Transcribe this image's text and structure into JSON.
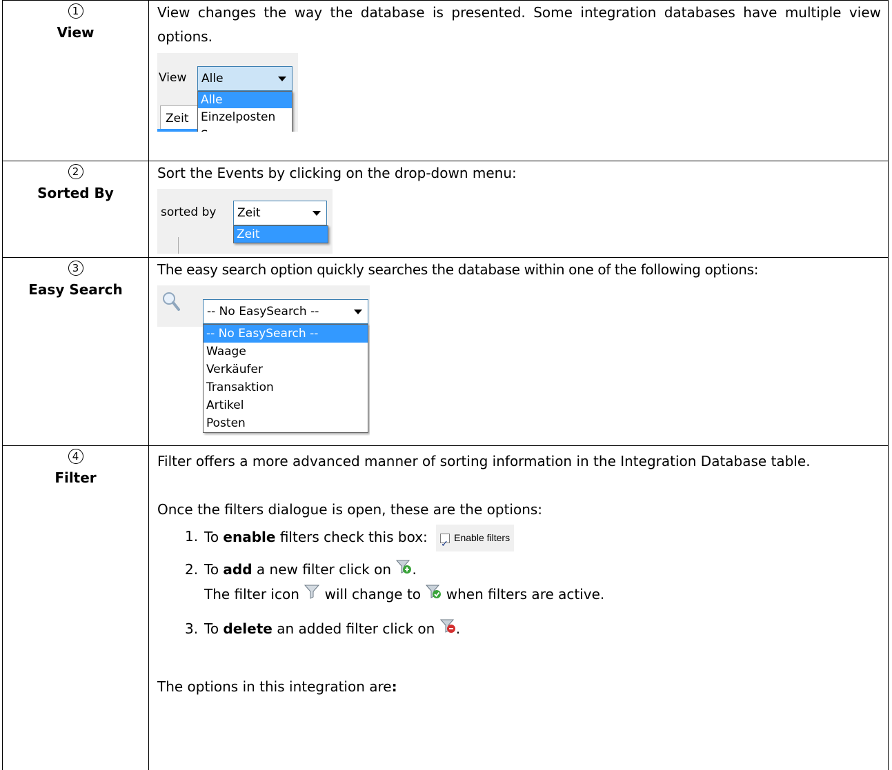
{
  "rows": [
    {
      "number": "1",
      "label": "View",
      "text": "View changes the way the database is presented. Some integration databases have multiple view options.",
      "snapshot": {
        "field_label": "View",
        "selected_value": "Alle",
        "options": [
          "Alle",
          "Einzelposten",
          "Summe"
        ],
        "column_header": "Zeit"
      }
    },
    {
      "number": "2",
      "label": "Sorted By",
      "text": "Sort the Events by clicking on the drop-down menu:",
      "snapshot": {
        "field_label": "sorted by",
        "selected_value": "Zeit",
        "options": [
          "Zeit"
        ]
      }
    },
    {
      "number": "3",
      "label": "Easy Search",
      "text": "The easy search option quickly searches the database within one of the following options:",
      "snapshot": {
        "icon": "magnifier-icon",
        "selected_value": "-- No EasySearch --",
        "options": [
          "-- No EasySearch --",
          "Waage",
          "Verkäufer",
          "Transaktion",
          "Artikel",
          "Posten"
        ]
      }
    },
    {
      "number": "4",
      "label": "Filter",
      "intro": "Filter offers a more advanced manner of sorting information in the Integration Database table.",
      "dialog_text": "Once the filters dialogue is open, these are the options:",
      "steps": [
        {
          "n": "1.",
          "pre": "To ",
          "bold": "enable",
          "post": " filters check this box:",
          "checkbox_label": "Enable filters"
        },
        {
          "n": "2.",
          "pre": "To ",
          "bold": "add",
          "post": " a new filter click on ",
          "end": ".",
          "line2_a": "The filter icon ",
          "line2_b": " will change to ",
          "line2_c": " when filters are active."
        },
        {
          "n": "3.",
          "pre": "To ",
          "bold": "delete",
          "post": " an added filter click on ",
          "end": "."
        }
      ],
      "options_text": "The options in this integration are",
      "options_colon": ":"
    }
  ],
  "colors": {
    "border": "#000000",
    "selection": "#3399ff",
    "combo_border": "#3c7fb1"
  }
}
